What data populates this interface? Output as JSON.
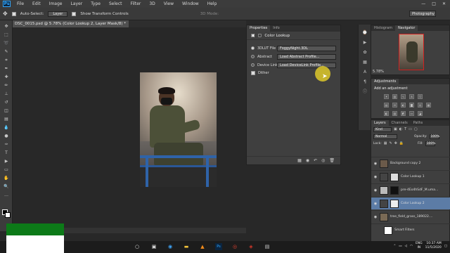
{
  "app": {
    "logo": "Ps",
    "window_controls": [
      "—",
      "□",
      "✕"
    ]
  },
  "menu": [
    "File",
    "Edit",
    "Image",
    "Layer",
    "Type",
    "Select",
    "Filter",
    "3D",
    "View",
    "Window",
    "Help"
  ],
  "options_bar": {
    "auto_select_label": "Auto-Select:",
    "auto_select_value": "Layer",
    "transform_label": "Show Transform Controls",
    "mode_label": "3D Mode:",
    "workspace": "Photography"
  },
  "document": {
    "tab_title": "DSC_0015.psd @ 5.78% (Color Lookup 2, Layer Mask/8) *",
    "status": "Doc: 99.7M/789.2M"
  },
  "properties": {
    "tabs": [
      "Properties",
      "Info"
    ],
    "title": "Color Lookup",
    "rows": [
      {
        "label": "3DLUT File",
        "value": "FoggyNight.3DL",
        "selected": true
      },
      {
        "label": "Abstract",
        "value": "Load Abstract Profile...",
        "selected": false
      },
      {
        "label": "Device Link",
        "value": "Load DeviceLink Profile...",
        "selected": false
      }
    ],
    "dither_label": "Dither",
    "footer_icons": [
      "▦",
      "◉",
      "↶",
      "◎",
      "🗑"
    ]
  },
  "navigator": {
    "tabs": [
      "Histogram",
      "Navigator"
    ],
    "zoom": "5.78%"
  },
  "adjustments": {
    "tabs": [
      "Adjustments"
    ],
    "add_label": "Add an adjustment"
  },
  "layers": {
    "tabs": [
      "Layers",
      "Channels",
      "Paths"
    ],
    "kind": "Kind",
    "blend_mode": "Normal",
    "opacity_label": "Opacity:",
    "opacity": "100%",
    "lock_label": "Lock:",
    "fill_label": "Fill:",
    "fill": "100%",
    "items": [
      {
        "name": "Background copy 2",
        "selected": false,
        "thumb": "#6b5a4a"
      },
      {
        "name": "Color Lookup 1",
        "selected": false,
        "thumb": "#dddddd"
      },
      {
        "name": "pre-4Eo4hSdF_M.uma...",
        "selected": false,
        "thumb": "#111111"
      },
      {
        "name": "Color Lookup 2",
        "selected": true,
        "thumb": "#eeeeee"
      },
      {
        "name": "tree_field_grass_189022....",
        "selected": false,
        "thumb": "#7a6a55"
      },
      {
        "name": "Smart Filters",
        "selected": false,
        "thumb": "#ffffff"
      }
    ]
  },
  "taskbar": {
    "lang_top": "ENG",
    "lang_bottom": "IN",
    "time": "10:37 AM",
    "date": "11/5/2020"
  }
}
